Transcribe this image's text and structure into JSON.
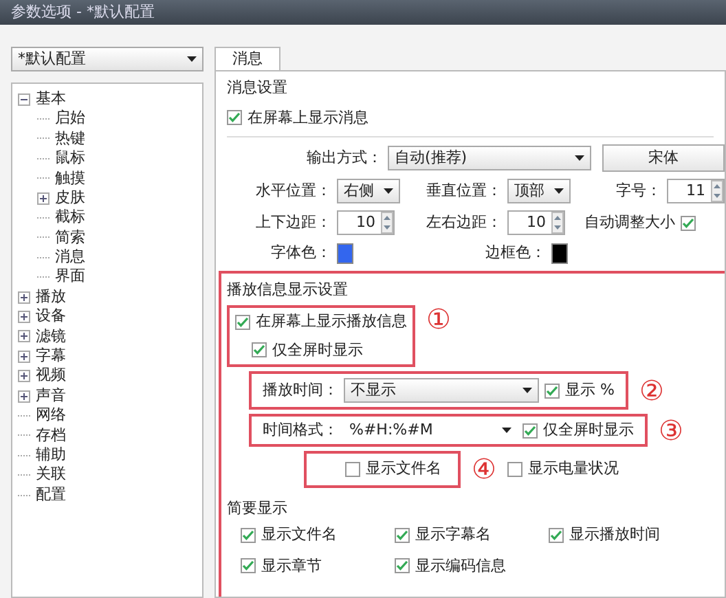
{
  "window": {
    "title": "参数选项 - *默认配置"
  },
  "profile_dropdown": {
    "value": "*默认配置"
  },
  "tree": [
    {
      "label": "基本",
      "expanded": true,
      "children": [
        {
          "label": "启始"
        },
        {
          "label": "热键"
        },
        {
          "label": "鼠标"
        },
        {
          "label": "触摸"
        },
        {
          "label": "皮肤",
          "expanded": false
        },
        {
          "label": "截标"
        },
        {
          "label": "简索"
        },
        {
          "label": "消息"
        },
        {
          "label": "界面"
        }
      ]
    },
    {
      "label": "播放",
      "expanded": false
    },
    {
      "label": "设备",
      "expanded": false
    },
    {
      "label": "滤镜",
      "expanded": false
    },
    {
      "label": "字幕",
      "expanded": false
    },
    {
      "label": "视频",
      "expanded": false
    },
    {
      "label": "声音",
      "expanded": false
    },
    {
      "label": "网络"
    },
    {
      "label": "存档"
    },
    {
      "label": "辅助"
    },
    {
      "label": "关联"
    },
    {
      "label": "配置"
    }
  ],
  "tabs": [
    {
      "label": "消息",
      "selected": true
    }
  ],
  "message_settings": {
    "title": "消息设置",
    "show_messages": {
      "label": "在屏幕上显示消息",
      "checked": true
    },
    "output_mode": {
      "label": "输出方式：",
      "value": "自动(推荐)"
    },
    "font_button": "宋体",
    "horizontal_position": {
      "label": "水平位置：",
      "value": "右侧"
    },
    "vertical_position": {
      "label": "垂直位置：",
      "value": "顶部"
    },
    "font_size": {
      "label": "字号：",
      "value": "11"
    },
    "vertical_margin": {
      "label": "上下边距：",
      "value": "10"
    },
    "horizontal_margin": {
      "label": "左右边距：",
      "value": "10"
    },
    "auto_resize": {
      "label": "自动调整大小",
      "checked": true
    },
    "font_color": {
      "label": "字体色：",
      "color": "#3366ee"
    },
    "border_color": {
      "label": "边框色：",
      "color": "#000000"
    }
  },
  "playback_info": {
    "title": "播放信息显示设置",
    "show_on_screen": {
      "label": "在屏幕上显示播放信息",
      "checked": true
    },
    "fullscreen_only": {
      "label": "仅全屏时显示",
      "checked": true
    },
    "play_time": {
      "label": "播放时间：",
      "value": "不显示"
    },
    "show_percent": {
      "label": "显示 %",
      "checked": true
    },
    "time_format": {
      "label": "时间格式：",
      "value": "%#H:%#M"
    },
    "time_fullscreen_only": {
      "label": "仅全屏时显示",
      "checked": true
    },
    "show_filename": {
      "label": "显示文件名",
      "checked": false
    },
    "show_battery": {
      "label": "显示电量状况",
      "checked": false
    },
    "callouts": [
      "①",
      "②",
      "③",
      "④"
    ]
  },
  "brief_display": {
    "title": "简要显示",
    "items": [
      {
        "label": "显示文件名",
        "checked": true
      },
      {
        "label": "显示字幕名",
        "checked": true
      },
      {
        "label": "显示播放时间",
        "checked": true
      },
      {
        "label": "显示章节",
        "checked": true
      },
      {
        "label": "显示编码信息",
        "checked": true
      }
    ]
  }
}
